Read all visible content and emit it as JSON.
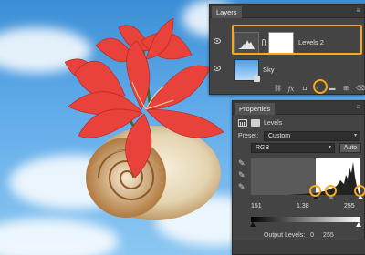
{
  "layers_panel": {
    "tab": "Layers",
    "layers": [
      {
        "name": "Levels 2"
      },
      {
        "name": "Sky"
      }
    ],
    "footer_icons": [
      "link-icon",
      "fx-icon",
      "mask-icon",
      "adjustment-icon",
      "folder-icon",
      "new-layer-icon",
      "trash-icon"
    ]
  },
  "properties_panel": {
    "tab": "Properties",
    "subtitle": "Levels",
    "preset_label": "Preset:",
    "preset_value": "Custom",
    "channel_value": "RGB",
    "auto_label": "Auto",
    "input_levels": {
      "black": "151",
      "gray": "1.38",
      "white": "255"
    },
    "output_levels_label": "Output Levels:",
    "output_levels": {
      "black": "0",
      "white": "255"
    }
  },
  "colors": {
    "highlight": "#f6a91a",
    "panel_bg": "#444444",
    "sky": "#4f9ee6"
  }
}
